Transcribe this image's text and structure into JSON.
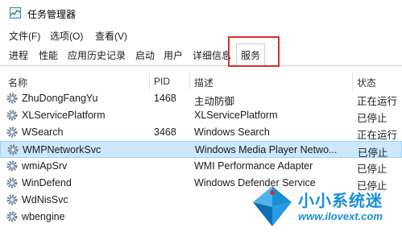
{
  "window": {
    "title": "任务管理器"
  },
  "menu": [
    {
      "label": "文件(F)"
    },
    {
      "label": "选项(O)"
    },
    {
      "label": "查看(V)"
    }
  ],
  "tabs": [
    {
      "label": "进程"
    },
    {
      "label": "性能"
    },
    {
      "label": "应用历史记录"
    },
    {
      "label": "启动"
    },
    {
      "label": "用户"
    },
    {
      "label": "详细信息"
    },
    {
      "label": "服务",
      "active": true
    }
  ],
  "table": {
    "columns": [
      "名称",
      "PID",
      "描述",
      "状态"
    ],
    "rows": [
      {
        "name": "ZhuDongFangYu",
        "pid": "1468",
        "desc": "主动防御",
        "status": "正在运行"
      },
      {
        "name": "XLServicePlatform",
        "pid": "",
        "desc": "XLServicePlatform",
        "status": "已停止"
      },
      {
        "name": "WSearch",
        "pid": "3468",
        "desc": "Windows Search",
        "status": "正在运行"
      },
      {
        "name": "WMPNetworkSvc",
        "pid": "",
        "desc": "Windows Media Player Netwo...",
        "status": "已停止",
        "selected": true
      },
      {
        "name": "wmiApSrv",
        "pid": "",
        "desc": "WMI Performance Adapter",
        "status": "已停止"
      },
      {
        "name": "WinDefend",
        "pid": "",
        "desc": "Windows Defender Service",
        "status": "已停止"
      },
      {
        "name": "WdNisSvc",
        "pid": "",
        "desc": "",
        "status": ""
      },
      {
        "name": "wbengine",
        "pid": "",
        "desc": "",
        "status": ""
      }
    ]
  },
  "watermark": {
    "title": "小小系统迷",
    "url": "www.ilovext.com"
  },
  "colors": {
    "highlight": "#d9302b",
    "selection": "#cce8ff",
    "watermark": "#1a8fd6"
  }
}
